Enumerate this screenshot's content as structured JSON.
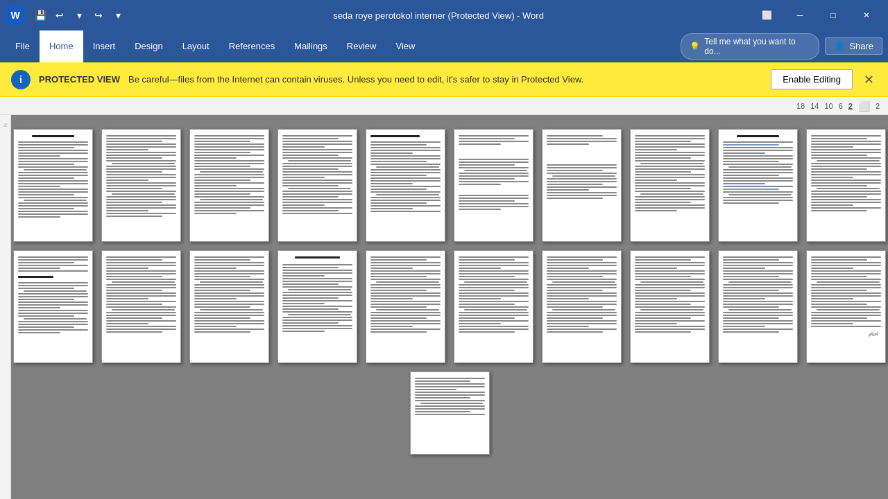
{
  "title_bar": {
    "document_title": "seda roye perotokol interner (Protected View) - Word",
    "minimize_label": "─",
    "maximize_label": "□",
    "close_label": "✕",
    "word_logo": "W",
    "undo_icon": "↩",
    "redo_icon": "↪"
  },
  "ribbon": {
    "tabs": [
      "File",
      "Home",
      "Insert",
      "Design",
      "Layout",
      "References",
      "Mailings",
      "Review",
      "View"
    ],
    "active_tab": "Home",
    "search_placeholder": "Tell me what you want to do...",
    "share_label": "Share"
  },
  "protected_view": {
    "label": "PROTECTED VIEW",
    "message": "Be careful—files from the Internet can contain viruses. Unless you need to edit, it's safer to stay in Protected View.",
    "enable_editing_label": "Enable Editing",
    "close_icon": "✕"
  },
  "zoom": {
    "values": [
      "18",
      "14",
      "10",
      "6",
      "2"
    ],
    "active": "2",
    "percent_label": "2"
  },
  "pages": {
    "total": 21,
    "rows": [
      10,
      10,
      1
    ]
  }
}
